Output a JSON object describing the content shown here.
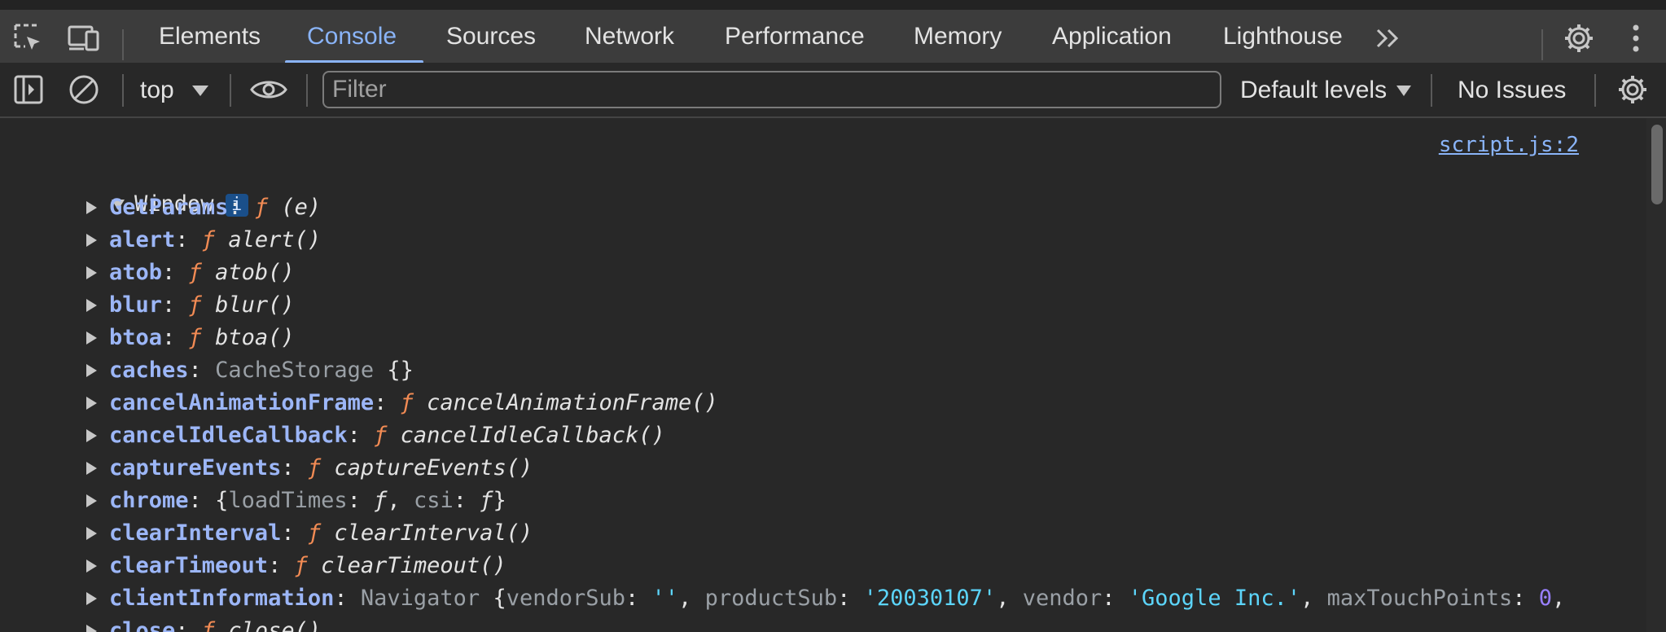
{
  "tabs": [
    {
      "label": "Elements",
      "active": false
    },
    {
      "label": "Console",
      "active": true
    },
    {
      "label": "Sources",
      "active": false
    },
    {
      "label": "Network",
      "active": false
    },
    {
      "label": "Performance",
      "active": false
    },
    {
      "label": "Memory",
      "active": false
    },
    {
      "label": "Application",
      "active": false
    },
    {
      "label": "Lighthouse",
      "active": false
    }
  ],
  "toolbar": {
    "context": "top",
    "filter_placeholder": "Filter",
    "levels": "Default levels",
    "issues": "No Issues"
  },
  "console": {
    "source_link": "script.js:2",
    "root_label": "Window",
    "root_badge": "i",
    "props": [
      {
        "key": "GetParams",
        "f": "ƒ",
        "val": "(e)"
      },
      {
        "key": "alert",
        "f": "ƒ",
        "val": "alert()"
      },
      {
        "key": "atob",
        "f": "ƒ",
        "val": "atob()"
      },
      {
        "key": "blur",
        "f": "ƒ",
        "val": "blur()"
      },
      {
        "key": "btoa",
        "f": "ƒ",
        "val": "btoa()"
      },
      {
        "key": "caches",
        "type": "CacheStorage",
        "val": "{}"
      },
      {
        "key": "cancelAnimationFrame",
        "f": "ƒ",
        "val": "cancelAnimationFrame()"
      },
      {
        "key": "cancelIdleCallback",
        "f": "ƒ",
        "val": "cancelIdleCallback()"
      },
      {
        "key": "captureEvents",
        "f": "ƒ",
        "val": "captureEvents()"
      },
      {
        "key": "chrome",
        "open": "{",
        "k1": "loadTimes",
        "v1": "ƒ",
        "sep": ", ",
        "k2": "csi",
        "v2": "ƒ",
        "close": "}"
      },
      {
        "key": "clearInterval",
        "f": "ƒ",
        "val": "clearInterval()"
      },
      {
        "key": "clearTimeout",
        "f": "ƒ",
        "val": "clearTimeout()"
      },
      {
        "key": "clientInformation",
        "type": "Navigator",
        "nav": {
          "open": "{",
          "k1": "vendorSub",
          "v1": "''",
          "k2": "productSub",
          "v2": "'20030107'",
          "k3": "vendor",
          "v3": "'Google Inc.'",
          "k4": "maxTouchPoints",
          "v4": "0"
        }
      },
      {
        "key": "close",
        "f": "ƒ",
        "val": "close()"
      }
    ]
  },
  "colors": {
    "accent": "#8ab4f8",
    "key": "#9cb6f7",
    "function_marker": "#f28b54",
    "string": "#5cd5fb",
    "number": "#9980ff"
  }
}
